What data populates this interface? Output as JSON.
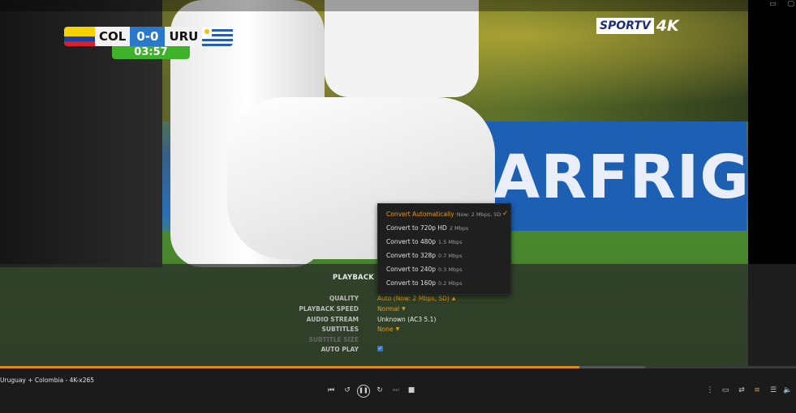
{
  "video": {
    "score_bug": {
      "home": "COL",
      "away": "URU",
      "score": "0-0",
      "clock": "03:57"
    },
    "broadcaster_logo": {
      "text": "SPORTV",
      "suffix": "4K"
    },
    "board_text": "ARFRIG"
  },
  "settings": {
    "title": "PLAYBACK SE",
    "rows": [
      {
        "label": "QUALITY",
        "value": "Auto (Now: 2 Mbps, SD)",
        "caret": "▲"
      },
      {
        "label": "PLAYBACK SPEED",
        "value": "Normal",
        "caret": "▼"
      },
      {
        "label": "AUDIO STREAM",
        "value": "Unknown (AC3 5.1)"
      },
      {
        "label": "SUBTITLES",
        "value": "None",
        "caret": "▼"
      },
      {
        "label": "SUBTITLE SIZE",
        "value": ""
      },
      {
        "label": "AUTO PLAY",
        "value": ""
      }
    ],
    "auto_play_checked": true
  },
  "quality_menu": {
    "items": [
      {
        "label": "Convert Automatically",
        "sub": "Now: 2 Mbps, SD",
        "selected": true
      },
      {
        "label": "Convert to 720p HD",
        "sub": "2 Mbps"
      },
      {
        "label": "Convert to 480p",
        "sub": "1.5 Mbps"
      },
      {
        "label": "Convert to 328p",
        "sub": "0.7 Mbps"
      },
      {
        "label": "Convert to 240p",
        "sub": "0.3 Mbps"
      },
      {
        "label": "Convert to 160p",
        "sub": "0.2 Mbps"
      }
    ],
    "check_icon": "✓"
  },
  "player": {
    "title": "Uruguay + Colombia - 4K-x265",
    "progress": 0.728,
    "buffered_to": 0.81,
    "accent_color": "#e0851c",
    "controls": {
      "previous": "previous-icon",
      "replay": "replay-10-icon",
      "pause": "pause-icon",
      "forward": "forward-30-icon",
      "next": "next-icon",
      "stop": "stop-icon"
    },
    "right_controls": [
      "more-icon",
      "fullscreen-icon",
      "shuffle-icon",
      "settings-sliders-icon",
      "playlist-icon",
      "volume-mute-icon"
    ]
  }
}
